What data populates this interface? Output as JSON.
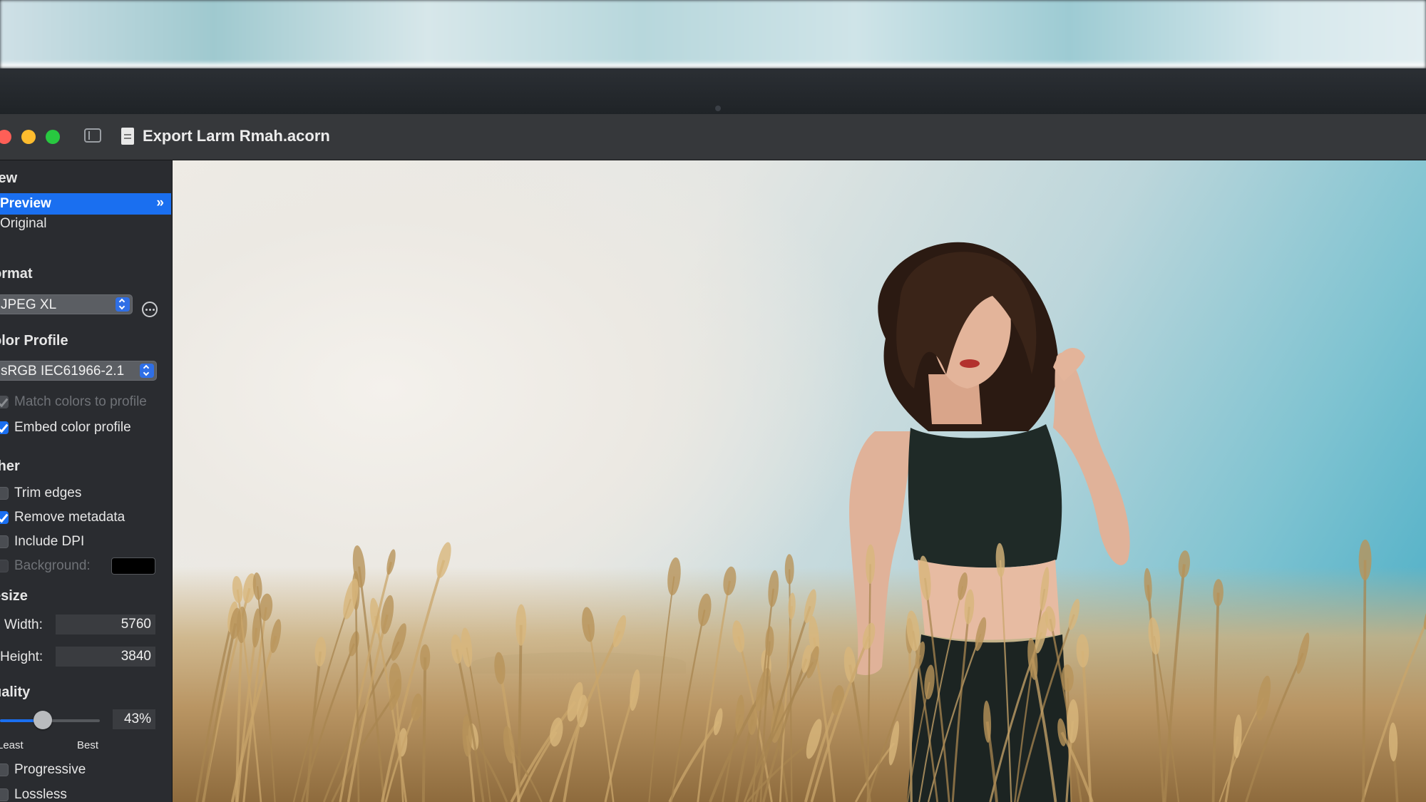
{
  "window": {
    "title": "Export Larm Rmah.acorn"
  },
  "icons": {
    "close": "close-traffic-light",
    "minimize": "minimize-traffic-light",
    "maximize": "maximize-traffic-light",
    "sidebar_toggle": "sidebar-toggle-icon",
    "document": "document-icon",
    "more_options": "ellipsis-circle-icon",
    "chevron": "double-chevron-right-icon"
  },
  "sidebar": {
    "view": {
      "heading": "iew",
      "items": [
        {
          "label": "Preview",
          "selected": true,
          "chevron": "»"
        },
        {
          "label": "Original",
          "selected": false
        }
      ]
    },
    "format": {
      "heading": "ormat",
      "selected": "JPEG XL"
    },
    "color_profile": {
      "heading": "olor Profile",
      "selected": "sRGB IEC61966-2.1",
      "options": [
        {
          "label": "Match colors to profile",
          "checked": true,
          "enabled": false
        },
        {
          "label": "Embed color profile",
          "checked": true,
          "enabled": true
        }
      ]
    },
    "other": {
      "heading": "ther",
      "options": [
        {
          "label": "Trim edges",
          "checked": false,
          "enabled": true
        },
        {
          "label": "Remove metadata",
          "checked": true,
          "enabled": true
        },
        {
          "label": "Include DPI",
          "checked": false,
          "enabled": true
        },
        {
          "label": "Background:",
          "checked": false,
          "enabled": false
        }
      ],
      "background_color": "#000000"
    },
    "resize": {
      "heading": "esize",
      "width_label": "Width:",
      "width_value": "5760",
      "height_label": "Height:",
      "height_value": "3840"
    },
    "quality": {
      "heading": "uality",
      "value_label": "43%",
      "value": 0.43,
      "min_label": "Least",
      "max_label": "Best",
      "options": [
        {
          "label": "Progressive",
          "checked": false
        },
        {
          "label": "Lossless",
          "checked": false
        }
      ]
    }
  },
  "colors": {
    "accent": "#1a6ff0",
    "sidebar_bg": "#2a2c30",
    "titlebar_bg": "#36383b"
  }
}
